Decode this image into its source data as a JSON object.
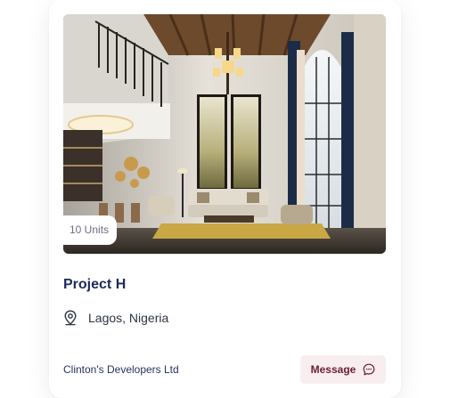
{
  "listing": {
    "image_alt": "Double-height living room interior",
    "units_badge": "10 Units",
    "title": "Project H",
    "location": "Lagos, Nigeria",
    "developer": "Clinton's Developers Ltd",
    "message_label": "Message"
  },
  "icons": {
    "location": "map-pin-icon",
    "message": "chat-bubble-icon"
  },
  "colors": {
    "title": "#1e2a5a",
    "message_bg": "#f8eef0",
    "message_text": "#6b1d30"
  }
}
